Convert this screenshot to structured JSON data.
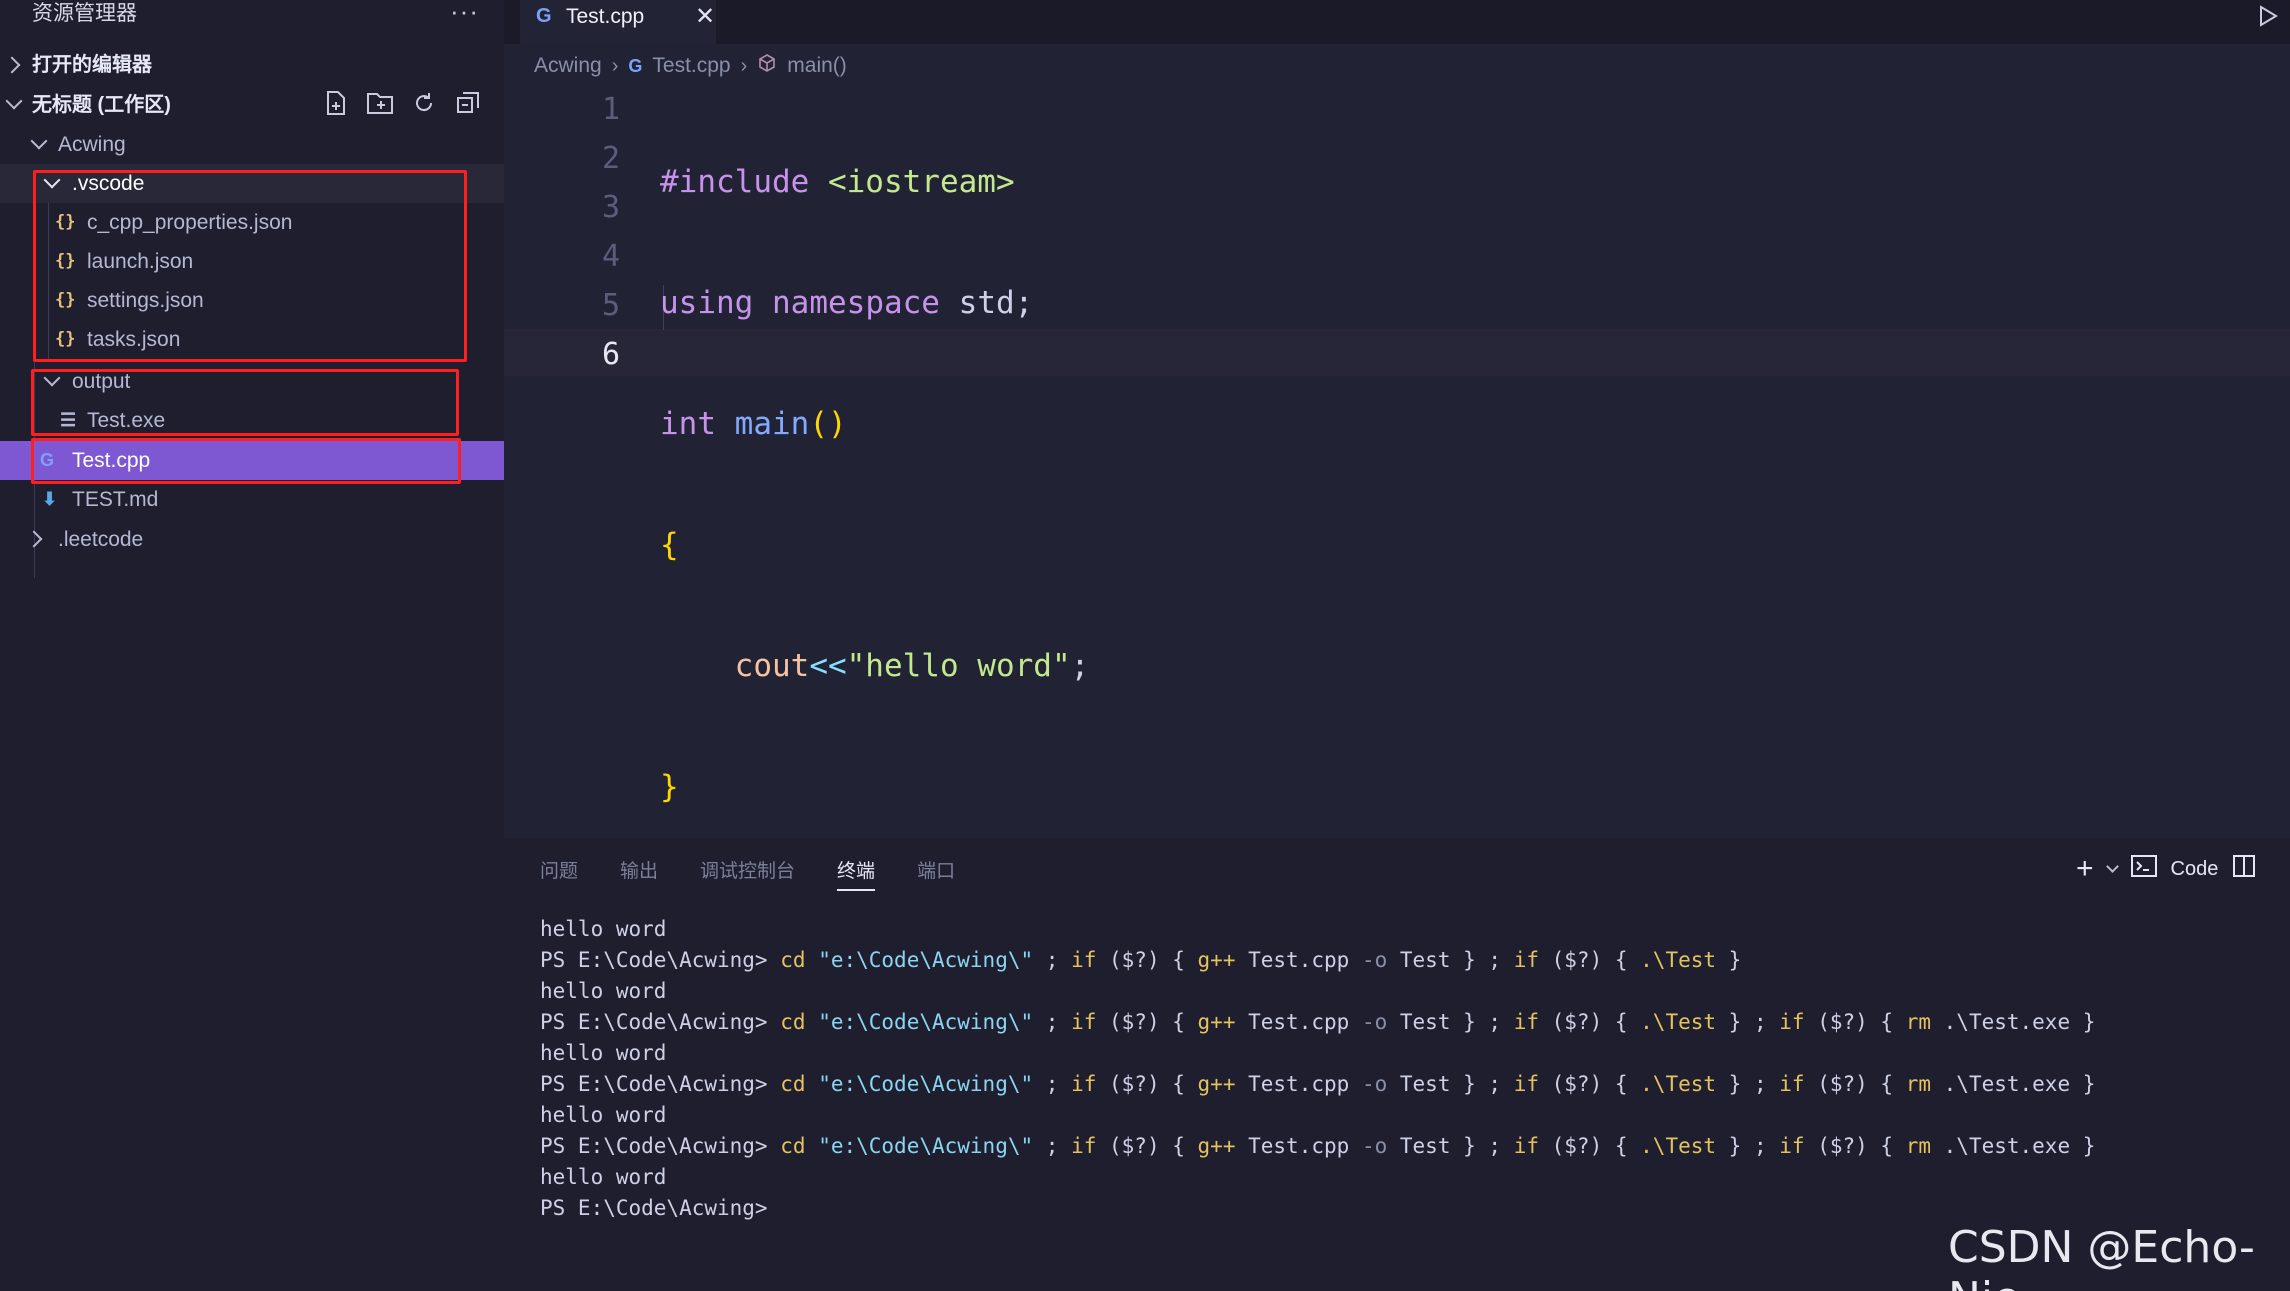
{
  "sidebar": {
    "title": "资源管理器",
    "more": "···",
    "open_editors": "打开的编辑器",
    "workspace": "无标题 (工作区)",
    "tree": {
      "acwing": "Acwing",
      "vscode": ".vscode",
      "c_cpp": "c_cpp_properties.json",
      "launch": "launch.json",
      "settings": "settings.json",
      "tasks": "tasks.json",
      "output": "output",
      "test_exe": "Test.exe",
      "test_cpp": "Test.cpp",
      "test_md": "TEST.md",
      "leetcode": ".leetcode"
    }
  },
  "editor": {
    "tab_label": "Test.cpp",
    "breadcrumb": [
      "Acwing",
      "Test.cpp",
      "main()"
    ],
    "line_numbers": [
      "1",
      "2",
      "3",
      "4",
      "5",
      "6"
    ],
    "current_line": "6"
  },
  "panel": {
    "tabs": [
      "问题",
      "输出",
      "调试控制台",
      "终端",
      "端口"
    ],
    "active_tab": "终端",
    "terminal_profile": "Code"
  },
  "terminal": {
    "out": "hello word",
    "prompt": "PS E:\\Code\\Acwing>",
    "cd": "cd",
    "path_str": "\"e:\\Code\\Acwing\\\"",
    "if_kw": "if",
    "gpp": "g++",
    "compile_args": "Test.cpp",
    "o_flag": "-o",
    "out_name": "Test",
    "run": ".\\Test",
    "rm": "rm",
    "exe": ".\\Test.exe",
    "cond": "($?)"
  },
  "watermark": "CSDN @Echo-Nie",
  "colors": {
    "accent": "#7e58d3",
    "highlight_box": "#ff1f1f"
  }
}
